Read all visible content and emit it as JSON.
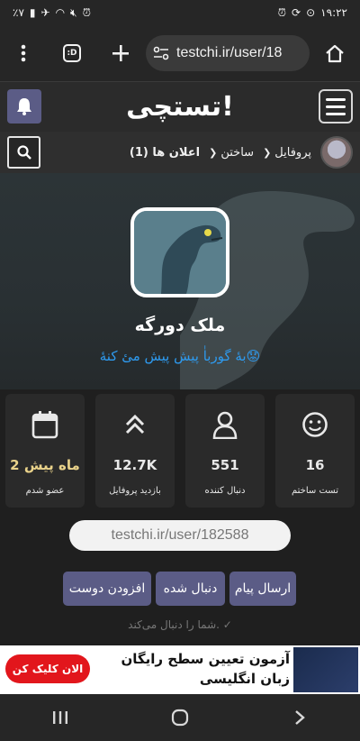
{
  "status_bar": {
    "battery": "٪۷",
    "time": "۱۹:۲۲"
  },
  "browser": {
    "tab_count": ":D",
    "url": "testchi.ir/user/18"
  },
  "site": {
    "logo": "تستچی!"
  },
  "nav": {
    "items": [
      {
        "label": "پروفایل",
        "icon": "chevron-down-icon"
      },
      {
        "label": "ساختن",
        "icon": "chevron-down-icon"
      },
      {
        "label": "اعلان ها (1)"
      }
    ]
  },
  "profile": {
    "name": "ملک دورگه",
    "bio": "بهٔ گورباٰ پیش پیش مئ کنهٔ😟"
  },
  "stats": [
    {
      "icon": "smiley-icon",
      "value": "16",
      "label": "تست ساختم"
    },
    {
      "icon": "user-icon",
      "value": "551",
      "label": "دنبال کننده"
    },
    {
      "icon": "double-chevron-up-icon",
      "value": "12.7K",
      "label": "بازدید پروفایل"
    },
    {
      "icon": "calendar-icon",
      "value": "2 ماه پیش",
      "label": "عضو شدم"
    }
  ],
  "profile_link": "testchi.ir/user/182588",
  "actions": {
    "send_message": "ارسال پیام",
    "followed": "دنبال شده",
    "add_friend": "افزودن دوست"
  },
  "follow_note": "شما را دنبال می‌کند.",
  "ad": {
    "text": "آزمون تعیین سطح رایگان زبان انگلیسی",
    "cta": "الان کلیک کن"
  },
  "colors": {
    "accent_button": "#5b5c86",
    "ad_cta": "#e2161c",
    "bio_link": "#2e9bf0",
    "joined_value": "#e9d28a"
  }
}
